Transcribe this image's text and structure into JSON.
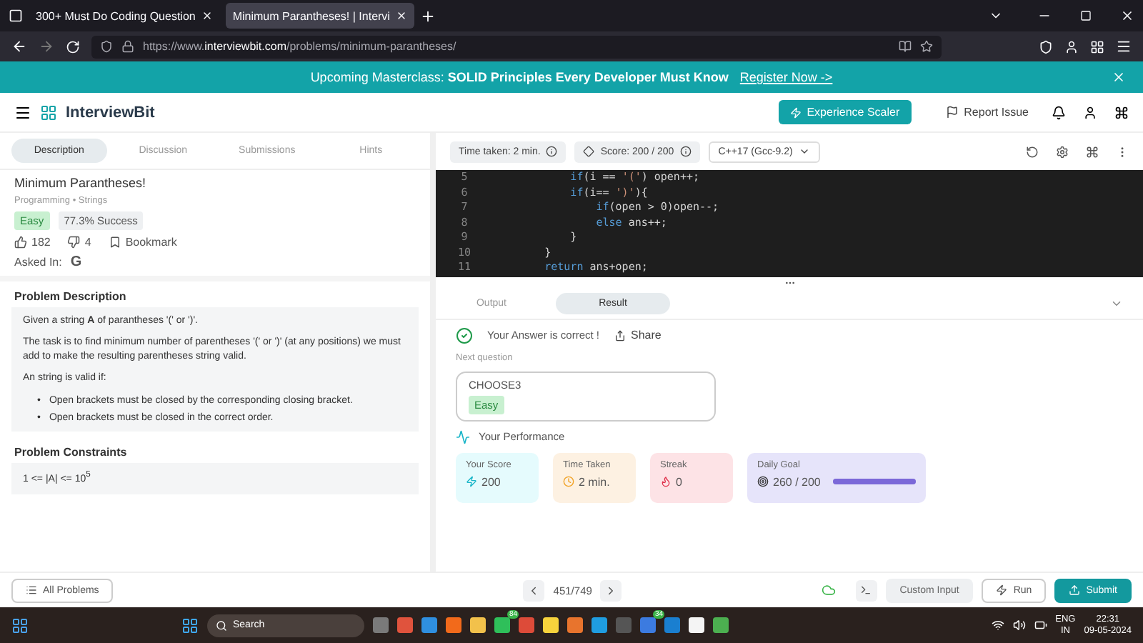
{
  "browser": {
    "tabs": [
      {
        "title": "300+ Must Do Coding Question",
        "selected": false
      },
      {
        "title": "Minimum Parantheses! | Intervi",
        "selected": true
      }
    ],
    "url": "https://www.**interviewbit.com**/problems/minimum-parantheses/"
  },
  "banner": {
    "text": "Upcoming Masterclass: **SOLID Principles Every Developer Must Know**",
    "link": "Register Now ->"
  },
  "header": {
    "logo": "InterviewBit",
    "cta": "Experience Scaler",
    "report": "Report Issue"
  },
  "problem_tabs": [
    {
      "label": "Description",
      "selected": true
    },
    {
      "label": "Discussion",
      "selected": false
    },
    {
      "label": "Submissions",
      "selected": false
    },
    {
      "label": "Hints",
      "selected": false
    }
  ],
  "problem": {
    "title": "Minimum Parantheses!",
    "category": "Programming • Strings",
    "difficulty": "Easy",
    "success": "77.3% Success",
    "likes": "182",
    "dislikes": "4",
    "bookmark": "Bookmark",
    "asked_in": "Asked In:",
    "company": "G"
  },
  "description": {
    "heading": "Problem Description",
    "paragraphs": [
      "Given a string **A** of parantheses  '(' or ')'.",
      "The task is to find minimum number of parentheses '(' or ')' (at any positions) we must add to make the resulting parentheses string valid.",
      "An string is valid if:"
    ],
    "marker": "•",
    "bullets": [
      "Open brackets must be closed by the corresponding closing bracket.",
      "Open brackets must be closed in the correct order."
    ]
  },
  "constraints": {
    "heading": "Problem Constraints",
    "items": [
      "1 <= |A| <= 10$^{5}$"
    ]
  },
  "editor": {
    "time": "Time taken: 2 min.",
    "score": "Score: 200 / 200",
    "language": "C++17 (Gcc-9.2)",
    "lines": [
      {
        "number": "5",
        "tokens": [
          {
            "kind": "keyword",
            "text": "            if"
          },
          {
            "kind": "plain",
            "text": "(i == "
          },
          {
            "kind": "string",
            "text": "'('"
          },
          {
            "kind": "plain",
            "text": ") open++;"
          }
        ]
      },
      {
        "number": "6",
        "tokens": [
          {
            "kind": "keyword",
            "text": "            if"
          },
          {
            "kind": "plain",
            "text": "(i== "
          },
          {
            "kind": "string",
            "text": "')'"
          },
          {
            "kind": "plain",
            "text": "){"
          }
        ]
      },
      {
        "number": "7",
        "tokens": [
          {
            "kind": "keyword",
            "text": "                if"
          },
          {
            "kind": "plain",
            "text": "(open > 0)open--;"
          }
        ]
      },
      {
        "number": "8",
        "tokens": [
          {
            "kind": "keyword",
            "text": "                else"
          },
          {
            "kind": "plain",
            "text": " ans++;"
          }
        ]
      },
      {
        "number": "9",
        "tokens": [
          {
            "kind": "plain",
            "text": "            }"
          }
        ]
      },
      {
        "number": "10",
        "tokens": [
          {
            "kind": "plain",
            "text": "        }"
          }
        ]
      },
      {
        "number": "11",
        "tokens": [
          {
            "kind": "keyword",
            "text": "        return"
          },
          {
            "kind": "plain",
            "text": " ans+open;"
          }
        ]
      }
    ]
  },
  "result": {
    "tabs": [
      {
        "label": "Output",
        "selected": false
      },
      {
        "label": "Result",
        "selected": true
      }
    ],
    "status": "Your Answer is correct !",
    "share": "Share",
    "next_label": "Next question",
    "next": {
      "title": "CHOOSE3",
      "difficulty": "Easy"
    },
    "performance": "Your Performance",
    "stats": [
      {
        "kind": "score",
        "label": "Your Score",
        "value": "200"
      },
      {
        "kind": "time",
        "label": "Time Taken",
        "value": "2 min."
      },
      {
        "kind": "streak",
        "label": "Streak",
        "value": "0"
      },
      {
        "kind": "goal",
        "label": "Daily Goal",
        "value": "260 / 200",
        "level": 1
      }
    ]
  },
  "footer": {
    "all_problems": "All Problems",
    "pager": "451/749",
    "custom_input": "Custom Input",
    "run": "Run",
    "submit": "Submit"
  },
  "taskbar": {
    "search": "Search",
    "apps": [
      {
        "color": "#7a7a7a"
      },
      {
        "color": "#e0533d"
      },
      {
        "color": "#2f8fe0"
      },
      {
        "color": "#f26a1b"
      },
      {
        "color": "#f2c14b"
      },
      {
        "color": "#2fbf5a",
        "badge": "84"
      },
      {
        "color": "#dd4b39"
      },
      {
        "color": "#f7d33c"
      },
      {
        "color": "#e8742d"
      },
      {
        "color": "#1f9de0"
      },
      {
        "color": "#555555"
      },
      {
        "color": "#3c7be0",
        "badge": "34"
      },
      {
        "color": "#1a7fd0"
      },
      {
        "color": "#f4f4f4"
      },
      {
        "color": "#4caf50"
      }
    ],
    "lang": "ENG",
    "region": "IN",
    "time": "22:31",
    "date": "09-05-2024"
  }
}
